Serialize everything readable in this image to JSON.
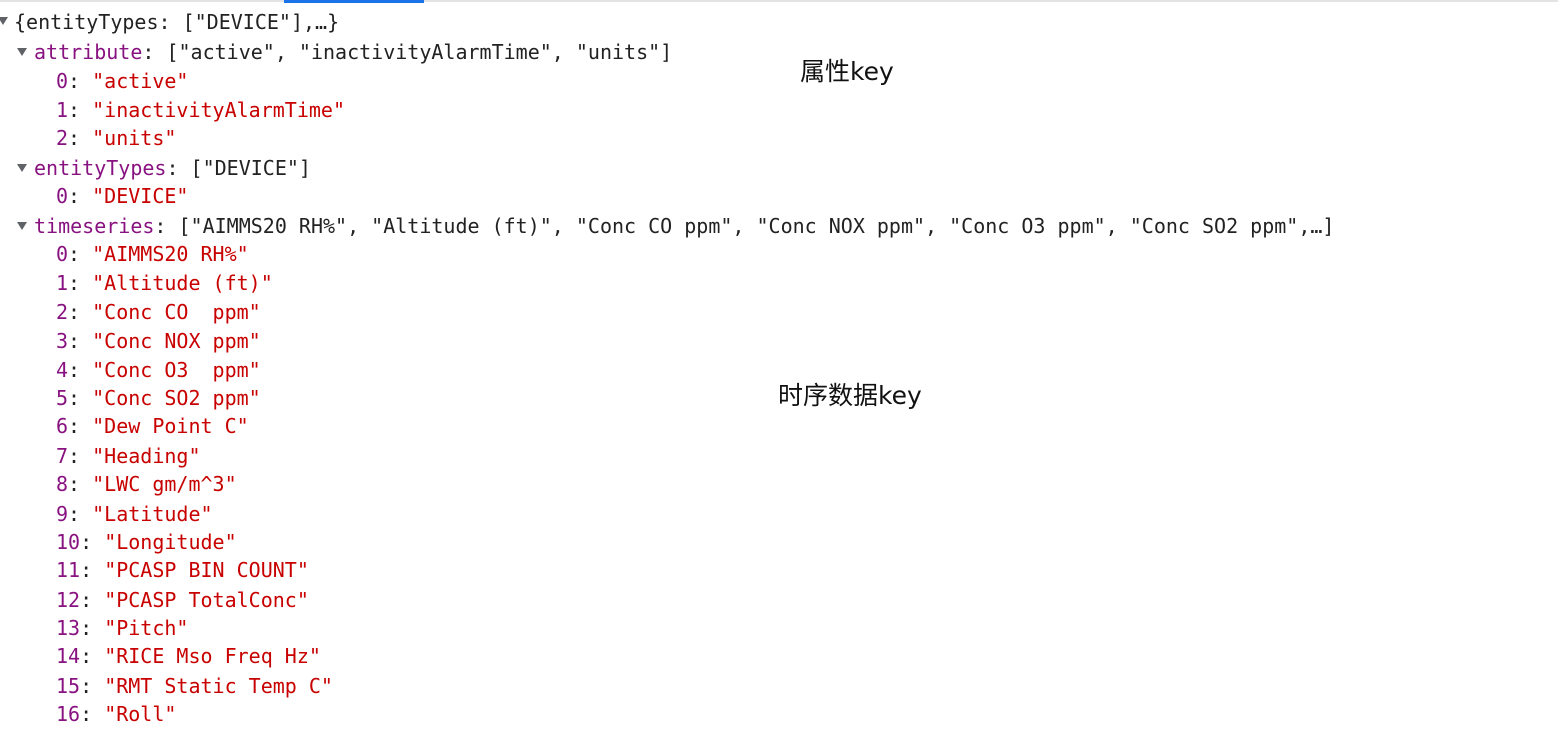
{
  "root_summary": "{entityTypes: [\"DEVICE\"],…}",
  "sections": [
    {
      "key": "attribute",
      "summary": "[\"active\", \"inactivityAlarmTime\", \"units\"]",
      "items": [
        {
          "index": "0",
          "value": "\"active\""
        },
        {
          "index": "1",
          "value": "\"inactivityAlarmTime\""
        },
        {
          "index": "2",
          "value": "\"units\""
        }
      ]
    },
    {
      "key": "entityTypes",
      "summary": "[\"DEVICE\"]",
      "items": [
        {
          "index": "0",
          "value": "\"DEVICE\""
        }
      ]
    },
    {
      "key": "timeseries",
      "summary": "[\"AIMMS20 RH%\", \"Altitude (ft)\", \"Conc CO ppm\", \"Conc NOX ppm\", \"Conc O3 ppm\", \"Conc SO2 ppm\",…]",
      "items": [
        {
          "index": "0",
          "value": "\"AIMMS20 RH%\""
        },
        {
          "index": "1",
          "value": "\"Altitude (ft)\""
        },
        {
          "index": "2",
          "value": "\"Conc CO  ppm\""
        },
        {
          "index": "3",
          "value": "\"Conc NOX ppm\""
        },
        {
          "index": "4",
          "value": "\"Conc O3  ppm\""
        },
        {
          "index": "5",
          "value": "\"Conc SO2 ppm\""
        },
        {
          "index": "6",
          "value": "\"Dew Point C\""
        },
        {
          "index": "7",
          "value": "\"Heading\""
        },
        {
          "index": "8",
          "value": "\"LWC gm/m^3\""
        },
        {
          "index": "9",
          "value": "\"Latitude\""
        },
        {
          "index": "10",
          "value": "\"Longitude\""
        },
        {
          "index": "11",
          "value": "\"PCASP BIN COUNT\""
        },
        {
          "index": "12",
          "value": "\"PCASP TotalConc\""
        },
        {
          "index": "13",
          "value": "\"Pitch\""
        },
        {
          "index": "14",
          "value": "\"RICE Mso Freq Hz\""
        },
        {
          "index": "15",
          "value": "\"RMT Static Temp C\""
        },
        {
          "index": "16",
          "value": "\"Roll\""
        }
      ]
    }
  ],
  "annotations": {
    "attribute_note": "属性key",
    "timeseries_note": "时序数据key"
  }
}
